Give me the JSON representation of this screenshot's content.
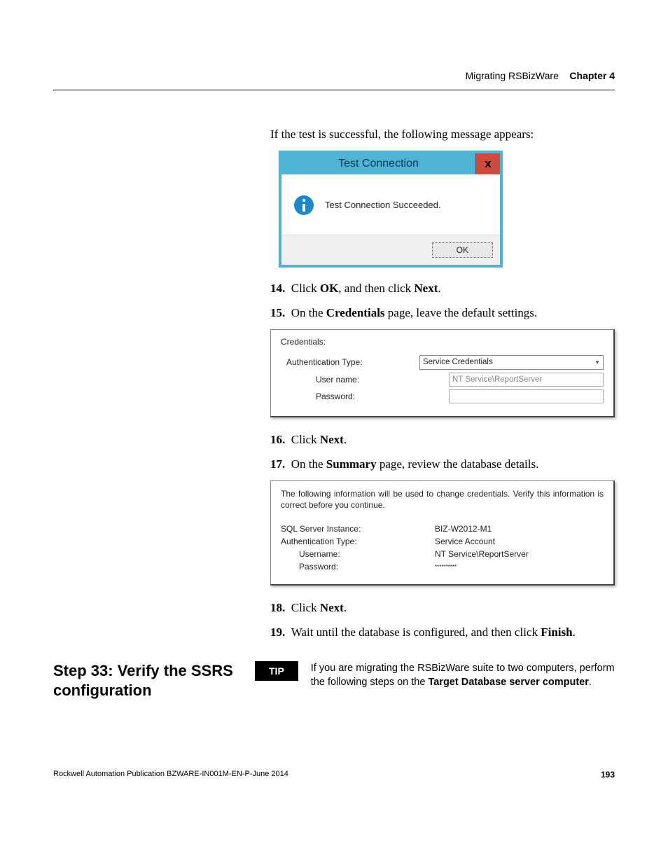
{
  "header": {
    "breadcrumb": "Migrating RSBizWare",
    "chapter": "Chapter 4"
  },
  "intro": "If the test is successful, the following message appears:",
  "dialog": {
    "title": "Test Connection",
    "close": "x",
    "message": "Test Connection Succeeded.",
    "ok": "OK"
  },
  "steps": {
    "s14": {
      "n": "14.",
      "pre": "Click ",
      "b1": "OK",
      "mid": ", and then click ",
      "b2": "Next",
      "post": "."
    },
    "s15": {
      "n": "15.",
      "pre": "On the ",
      "b1": "Credentials",
      "post": " page, leave the default settings."
    },
    "s16": {
      "n": "16.",
      "pre": "Click ",
      "b1": "Next",
      "post": "."
    },
    "s17": {
      "n": "17.",
      "pre": "On the ",
      "b1": "Summary",
      "post": " page, review the database details."
    },
    "s18": {
      "n": "18.",
      "pre": "Click ",
      "b1": "Next",
      "post": "."
    },
    "s19": {
      "n": "19.",
      "pre": "Wait until the database is configured, and then click ",
      "b1": "Finish",
      "post": "."
    }
  },
  "credentials_panel": {
    "title": "Credentials:",
    "auth_label": "Authentication Type:",
    "auth_value": "Service Credentials",
    "user_label": "User name:",
    "user_value": "NT Service\\ReportServer",
    "pass_label": "Password:"
  },
  "summary_panel": {
    "intro": "The following information will be used to change credentials. Verify this information is correct before you continue.",
    "rows": {
      "sql_l": "SQL Server Instance:",
      "sql_v": "BIZ-W2012-M1",
      "auth_l": "Authentication Type:",
      "auth_v": "Service Account",
      "user_l": "Username:",
      "user_v": "NT Service\\ReportServer",
      "pass_l": "Password:",
      "pass_v": "**********"
    }
  },
  "step33": {
    "title": "Step 33: Verify the SSRS configuration",
    "tip_label": "TIP",
    "tip_pre": "If you are migrating the RSBizWare suite to two computers, perform the following steps on the ",
    "tip_bold": "Target Database server computer",
    "tip_post": "."
  },
  "footer": {
    "pub": "Rockwell Automation Publication BZWARE-IN001M-EN-P-June 2014",
    "page": "193"
  }
}
